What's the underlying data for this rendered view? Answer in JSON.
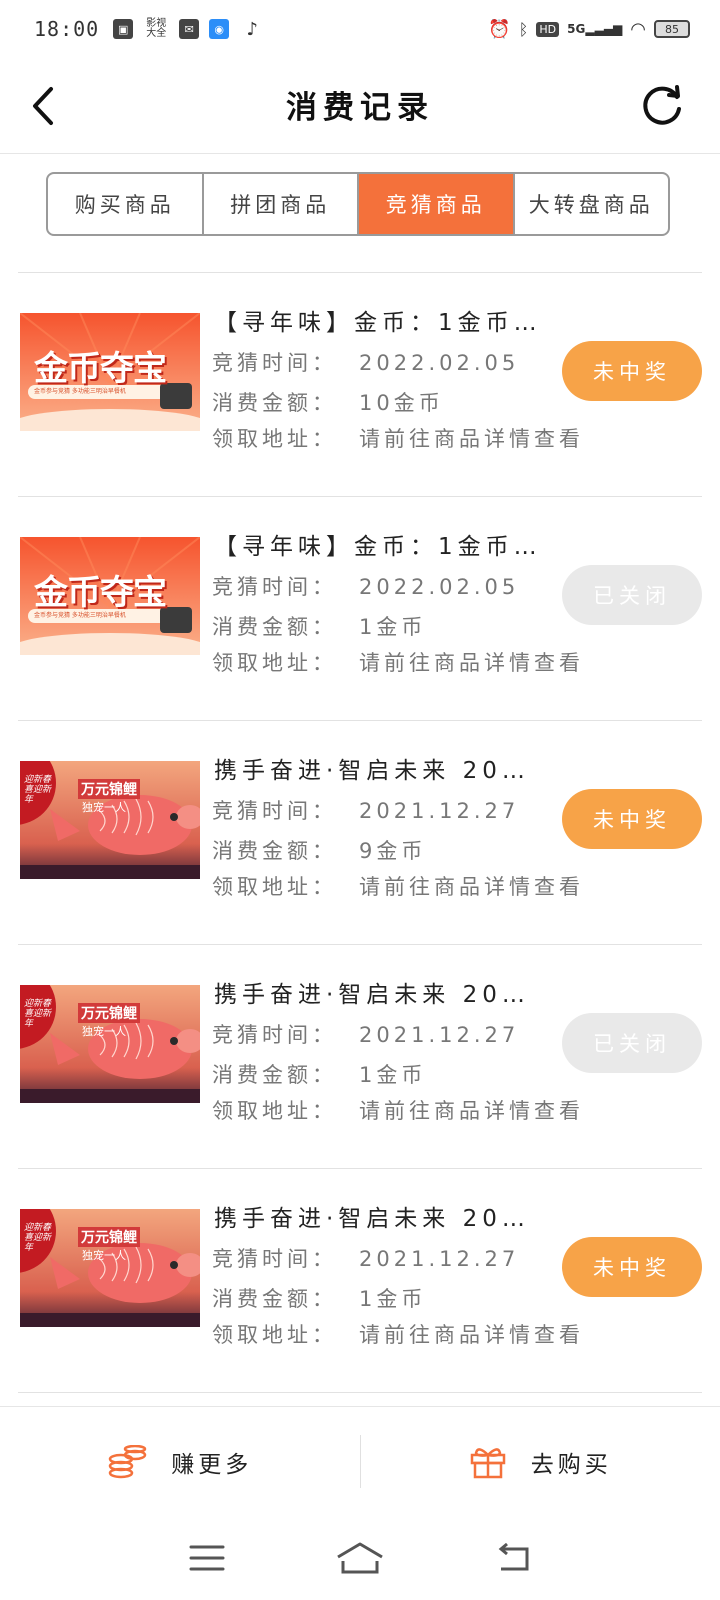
{
  "status_bar": {
    "time": "18:00",
    "icons": [
      "app-icon",
      "text-icon",
      "mail-icon",
      "baidu-icon",
      "tiktok-icon"
    ],
    "app_text": "影视\n大全",
    "right_icons": [
      "alarm-icon",
      "bluetooth-icon",
      "hd-icon",
      "5g-signal-icon",
      "wifi-icon",
      "battery-icon"
    ],
    "hd": "HD",
    "network": "5G",
    "battery": "85"
  },
  "header": {
    "title": "消费记录"
  },
  "tabs": [
    {
      "label": "购买商品",
      "active": false
    },
    {
      "label": "拼团商品",
      "active": false
    },
    {
      "label": "竞猜商品",
      "active": true
    },
    {
      "label": "大转盘商品",
      "active": false
    }
  ],
  "labels": {
    "time": "竞猜时间：",
    "amount": "消费金额：",
    "address": "领取地址："
  },
  "records": [
    {
      "title": "【寻年味】金币：1金币…",
      "time": "2022.02.05",
      "amount": "10金币",
      "address": "请前往商品详情查看",
      "status": "未中奖",
      "status_type": "lost",
      "image": "coin-treasure"
    },
    {
      "title": "【寻年味】金币：1金币…",
      "time": "2022.02.05",
      "amount": "1金币",
      "address": "请前往商品详情查看",
      "status": "已关闭",
      "status_type": "closed",
      "image": "coin-treasure"
    },
    {
      "title": "携手奋进·智启未来 20…",
      "time": "2021.12.27",
      "amount": "9金币",
      "address": "请前往商品详情查看",
      "status": "未中奖",
      "status_type": "lost",
      "image": "koi-fish"
    },
    {
      "title": "携手奋进·智启未来 20…",
      "time": "2021.12.27",
      "amount": "1金币",
      "address": "请前往商品详情查看",
      "status": "已关闭",
      "status_type": "closed",
      "image": "koi-fish"
    },
    {
      "title": "携手奋进·智启未来 20…",
      "time": "2021.12.27",
      "amount": "1金币",
      "address": "请前往商品详情查看",
      "status": "未中奖",
      "status_type": "lost",
      "image": "koi-fish"
    }
  ],
  "images": {
    "coin_banner_text": "金币夺宝",
    "coin_banner_sub": "金币参与竞猜 多功能三明治早餐机",
    "koi_banner_text": "万元锦鲤",
    "koi_banner_sub": "独宠一人",
    "koi_corner": "迎新春 喜迎新年"
  },
  "bottom_bar": {
    "earn_label": "赚更多",
    "buy_label": "去购买"
  },
  "colors": {
    "accent": "#f4713b",
    "lost_pill": "#f7a348",
    "closed_pill": "#e9e9e9"
  }
}
